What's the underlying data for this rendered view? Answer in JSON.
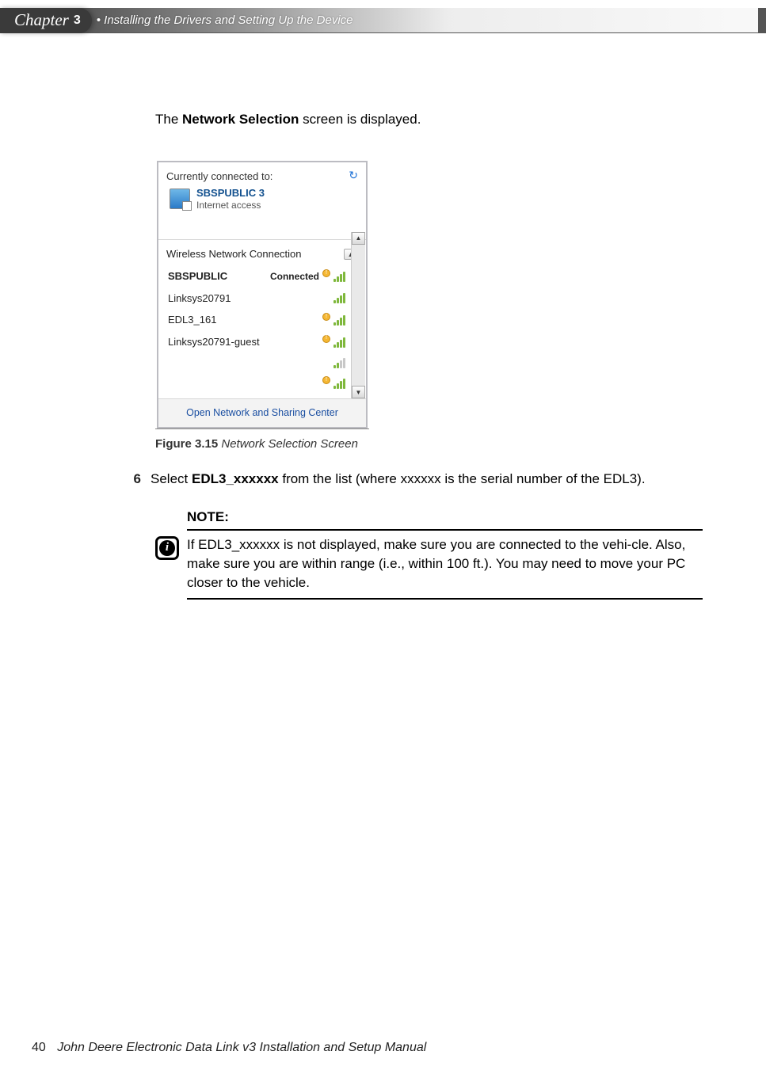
{
  "header": {
    "chapter_word": "Chapter",
    "chapter_num": "3",
    "title": "• Installing the Drivers and Setting Up the Device"
  },
  "intro": {
    "pre": "The ",
    "bold": "Network Selection",
    "post": " screen is displayed."
  },
  "flyout": {
    "connected_label": "Currently connected to:",
    "current": {
      "name": "SBSPUBLIC 3",
      "sub": "Internet access"
    },
    "section": "Wireless Network Connection",
    "networks": [
      {
        "name": "SBSPUBLIC",
        "status": "Connected",
        "signal": "g",
        "secure": true,
        "bold": true
      },
      {
        "name": "Linksys20791",
        "status": "",
        "signal": "g",
        "secure": false,
        "bold": false
      },
      {
        "name": "EDL3_161",
        "status": "",
        "signal": "g",
        "secure": true,
        "bold": false
      },
      {
        "name": "Linksys20791-guest",
        "status": "",
        "signal": "g",
        "secure": true,
        "bold": false
      },
      {
        "name": "",
        "status": "",
        "signal": "gw",
        "secure": false,
        "bold": false
      },
      {
        "name": "",
        "status": "",
        "signal": "g",
        "secure": true,
        "bold": false
      }
    ],
    "bottom_link": "Open Network and Sharing Center"
  },
  "figure": {
    "num": "Figure 3.15",
    "caption": "Network Selection Screen"
  },
  "step": {
    "num": "6",
    "pre": "Select ",
    "bold": "EDL3_xxxxxx",
    "post": " from the list (where xxxxxx is the serial number of the EDL3)."
  },
  "note": {
    "head": "NOTE:",
    "body": "If EDL3_xxxxxx is not displayed, make sure you are connected to the vehi-cle. Also, make sure you are within range (i.e., within 100 ft.). You may need to move your PC closer to the vehicle."
  },
  "footer": {
    "page": "40",
    "manual": "John Deere Electronic Data Link v3 Installation and Setup Manual"
  }
}
